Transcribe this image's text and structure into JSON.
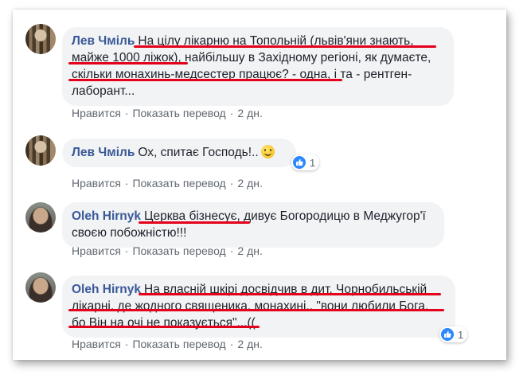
{
  "actions": {
    "like": "Нравится",
    "translate": "Показать перевод",
    "dot": "·"
  },
  "comments": [
    {
      "author": "Лев Чміль",
      "avatar": "lev-avatar",
      "lines": [
        "На цілу лікарню на Топольній (львів'яни знають,",
        "майже 1000 ліжок), найбільшу в Західному регіоні, як думаєте,",
        "скільки монахинь-медсестер працює? - одна, і та - рентген-",
        "лаборант..."
      ],
      "time": "2 дн."
    },
    {
      "author": "Лев Чміль",
      "avatar": "lev-avatar",
      "text": "Ох, спитає Господь!..",
      "emoji": "smile-emoji",
      "reaction_count": "1",
      "time": "2 дн."
    },
    {
      "author": "Oleh Hirnyk",
      "avatar": "oleh-avatar",
      "lines": [
        "Церква бізнесує, дивує Богородицю в Меджугор'ї",
        "своєю побожністю!!!"
      ],
      "time": "2 дн."
    },
    {
      "author": "Oleh Hirnyk",
      "avatar": "oleh-avatar",
      "lines": [
        "На власній шкірі досвідчив в дит. Чорнобильській",
        "лікарні, де жодного священика, монахині.. \"вони любили Бога,",
        "бо Він на очі не показується\"...(("
      ],
      "reaction_count": "1",
      "time": "2 дн."
    }
  ],
  "colors": {
    "author": "#385898",
    "bubble": "#f2f3f5",
    "underline": "#e3001b",
    "like": "#2d88ff"
  }
}
